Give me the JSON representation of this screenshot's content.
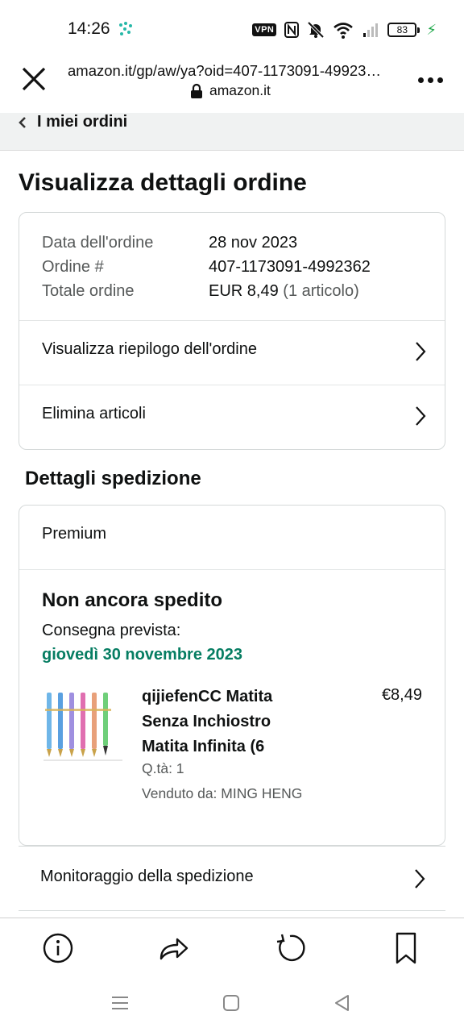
{
  "status_bar": {
    "time": "14:26",
    "vpn_label": "VPN",
    "battery_level": "83",
    "icons": [
      "nfc-icon",
      "mute-icon",
      "wifi-icon",
      "signal-icon",
      "battery-icon",
      "charging-icon"
    ]
  },
  "browser": {
    "url": "amazon.it/gp/aw/ya?oid=407-1173091-49923…",
    "domain": "amazon.it"
  },
  "breadcrumb": {
    "label": "I miei ordini"
  },
  "page": {
    "title": "Visualizza dettagli ordine"
  },
  "order_summary": {
    "rows": [
      {
        "label": "Data dell'ordine",
        "value": "28 nov 2023"
      },
      {
        "label": "Ordine #",
        "value": "407-1173091-4992362"
      },
      {
        "label": "Totale ordine",
        "value": "EUR 8,49",
        "extra": "(1 articolo)"
      }
    ],
    "links": [
      {
        "label": "Visualizza riepilogo dell'ordine"
      },
      {
        "label": "Elimina articoli"
      }
    ]
  },
  "shipment": {
    "section_title": "Dettagli spedizione",
    "service": "Premium",
    "status": "Non ancora spedito",
    "delivery_label": "Consegna prevista:",
    "delivery_date": "giovedì 30 novembre 2023",
    "item": {
      "title": "qijiefenCC Matita Senza Inchiostro Matita Infinita (6",
      "price": "€8,49",
      "quantity": "Q.tà: 1",
      "seller": "Venduto da: MING HENG"
    },
    "tracking_label": "Monitoraggio della spedizione"
  },
  "colors": {
    "delivery_green": "#067d62",
    "border": "#d5d9d9",
    "breadcrumb_bg": "#f0f2f2"
  }
}
